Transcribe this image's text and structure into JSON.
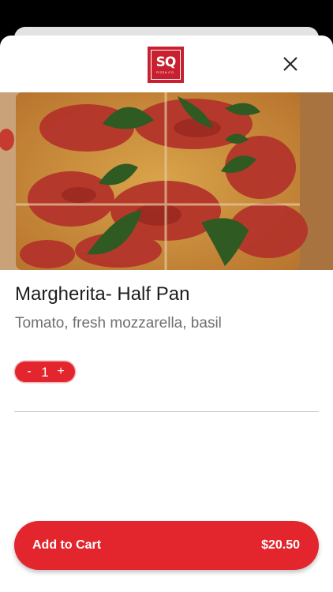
{
  "logo": {
    "mark": "SQ",
    "subtext": "PIZZA CO."
  },
  "item": {
    "name": "Margherita- Half Pan",
    "description": "Tomato, fresh mozzarella, basil",
    "image_icon": "pizza-photo"
  },
  "quantity": {
    "decrement_label": "-",
    "value": "1",
    "increment_label": "+"
  },
  "cart": {
    "label": "Add to Cart",
    "price": "$20.50"
  },
  "colors": {
    "accent": "#e3262d",
    "brand": "#c8202e",
    "background": "#ffffff"
  },
  "icons": {
    "close": "close-icon"
  }
}
